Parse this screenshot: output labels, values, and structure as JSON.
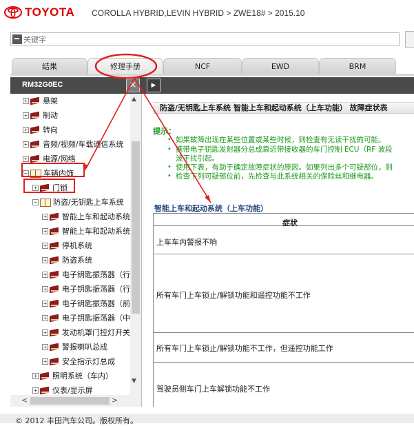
{
  "header": {
    "brand": "TOYOTA",
    "breadcrumb": "COROLLA HYBRID,LEVIN HYBRID > ZWE18# > 2015.10"
  },
  "search": {
    "placeholder": "关键字"
  },
  "tabs": [
    {
      "label": "结果"
    },
    {
      "label": "修理手册"
    },
    {
      "label": "NCF"
    },
    {
      "label": "EWD"
    },
    {
      "label": "BRM"
    }
  ],
  "doc_bar": {
    "doc_id": "RM32G0EC",
    "close_label": "×",
    "play_label": "▶"
  },
  "tree": {
    "items": [
      {
        "label": "悬架",
        "toggle": "+"
      },
      {
        "label": "制动",
        "toggle": "+"
      },
      {
        "label": "转向",
        "toggle": "+"
      },
      {
        "label": "音频/视频/车载通信系统",
        "toggle": "+"
      },
      {
        "label": "电源/网络",
        "toggle": "+"
      },
      {
        "label": "车辆内饰",
        "toggle": "−"
      },
      {
        "label": "门锁",
        "toggle": "+"
      },
      {
        "label": "防盗/无钥匙上车系统",
        "toggle": "−"
      },
      {
        "label": "智能上车和起动系统",
        "toggle": "+"
      },
      {
        "label": "智能上车和起动系统",
        "toggle": "+"
      },
      {
        "label": "停机系统",
        "toggle": "+"
      },
      {
        "label": "防盗系统",
        "toggle": "+"
      },
      {
        "label": "电子钥匙振荡器（行",
        "toggle": "+"
      },
      {
        "label": "电子钥匙振荡器（行",
        "toggle": "+"
      },
      {
        "label": "电子钥匙振荡器（前",
        "toggle": "+"
      },
      {
        "label": "电子钥匙振荡器（中",
        "toggle": "+"
      },
      {
        "label": "发动机罩门控灯开关",
        "toggle": "+"
      },
      {
        "label": "警报喇叭总成",
        "toggle": "+"
      },
      {
        "label": "安全指示灯总成",
        "toggle": "+"
      },
      {
        "label": "照明系统（车内）",
        "toggle": "+"
      },
      {
        "label": "仪表/显示屏",
        "toggle": "+"
      }
    ]
  },
  "content": {
    "title": "防盗/无钥匙上车系统  智能上车和起动系统（上车功能） 故障症状表",
    "hint_label": "提示：",
    "hints": [
      "如果故障出现在某些位置或某些时候，则检查有无读干扰的可能。",
      "携带电子钥匙发射器分总成靠近带接收器的车门控制 ECU（RF 波段",
      "波干扰引起。",
      "使用下表，有助于确定故障症状的原因。如果列出多个可疑部位，则",
      "检查下列可疑部位前，先检查与此系统相关的保险丝和继电器。"
    ],
    "section_title": "智能上车和起动系统（上车功能）",
    "table": {
      "header": "症状",
      "rows": [
        "上车车内警报不响",
        "所有车门上车锁止/解锁功能和遥控功能不工作",
        "所有车门上车锁止/解锁功能不工作，但遥控功能工作",
        "驾驶员侧车门上车解锁功能不工作"
      ]
    }
  },
  "footer": {
    "text": "© 2012 丰田汽车公司。版权所有。"
  },
  "colors": {
    "brand_red": "#d00000",
    "hint_green": "#1c9a1c",
    "annotation_red": "#e02020"
  }
}
